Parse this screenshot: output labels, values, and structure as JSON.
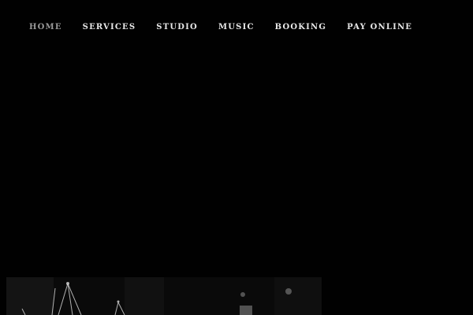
{
  "nav": {
    "items": [
      {
        "label": "HOME",
        "active": true
      },
      {
        "label": "SERVICES",
        "active": false
      },
      {
        "label": "STUDIO",
        "active": false
      },
      {
        "label": "MUSIC",
        "active": false
      },
      {
        "label": "BOOKING",
        "active": false
      },
      {
        "label": "PAY ONLINE",
        "active": false
      }
    ]
  },
  "colors": {
    "background": "#010101",
    "nav_text": "#e8e8e8",
    "nav_active_text": "#9a9a9a"
  },
  "hero": {
    "image": "studio-microphone-stands-photo"
  }
}
